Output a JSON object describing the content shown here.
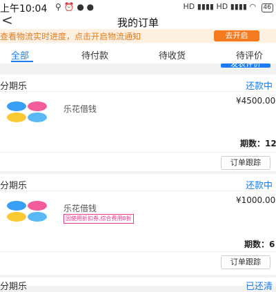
{
  "status_bar": {
    "time": "上午10:04",
    "left_icons": "⚲ ⏰ ● ●",
    "signal": "HD ▮▮▮▮ HD ▮▮▮▮",
    "wifi": "◠",
    "battery": "46"
  },
  "header": {
    "title": "我的订单",
    "back": "<"
  },
  "banner": {
    "text": "查看物流实时进度，点击开启物流通知",
    "button": "去开启"
  },
  "tabs": [
    "全部",
    "待付款",
    "待收货",
    "待评价"
  ],
  "top_partial_button": "发表评价",
  "orders": [
    {
      "brand": "分期乐",
      "status": "还款中",
      "product": "乐花借钱",
      "price": "¥4500.00",
      "periods_label": "期数：",
      "periods_value": "12",
      "track_button": "订单跟踪"
    },
    {
      "brand": "分期乐",
      "status": "还款中",
      "product": "乐花借钱",
      "promo": "因使用折扣券,综合费用8折",
      "price": "¥1000.00",
      "periods_label": "期数：",
      "periods_value": "6",
      "track_button": "订单跟踪"
    },
    {
      "brand": "分期乐",
      "status": "已还清"
    }
  ],
  "colors": {
    "accent": "#1a7cf0",
    "banner_bg": "#fdf0e1",
    "banner_text": "#e47d1f",
    "banner_button": "#f47b20",
    "logo_blue": "#3aa0f5",
    "logo_pink": "#f45b9a",
    "logo_yellow": "#fbc932",
    "logo_lightblue": "#5bb8f7"
  }
}
